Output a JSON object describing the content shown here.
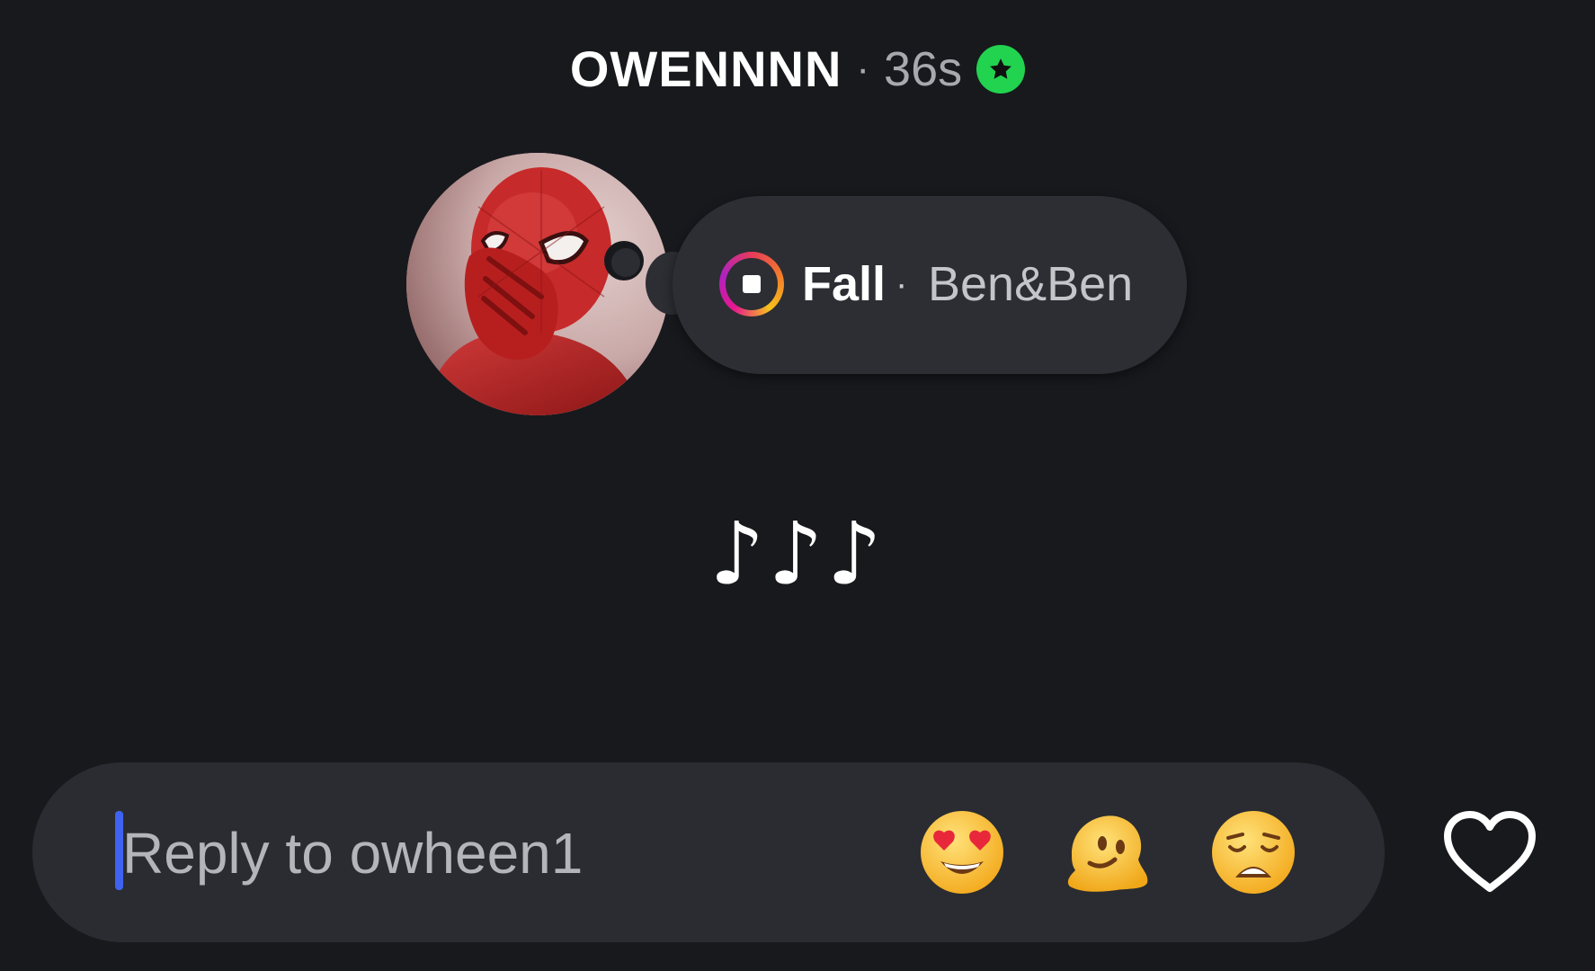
{
  "header": {
    "username": "OWENNNN",
    "separator": "·",
    "time": "36s",
    "badge_icon": "star-icon",
    "badge_color": "#21d34f"
  },
  "avatar": {
    "icon": "profile-photo"
  },
  "note": {
    "song_title": "Fall",
    "separator": "·",
    "artist": "Ben&Ben",
    "control_icon": "stop-icon"
  },
  "content": {
    "music_notes": "♪♪♪"
  },
  "reply": {
    "placeholder": "Reply to owheen1",
    "caret_color": "#3f63f0",
    "quick_reactions": [
      {
        "name": "heart-eyes-emoji"
      },
      {
        "name": "melting-face-emoji"
      },
      {
        "name": "weary-face-emoji"
      }
    ],
    "like_icon": "heart-outline-icon"
  },
  "colors": {
    "background": "#18191d",
    "bubble": "#2c2e33",
    "reply_bar": "#2a2c31"
  }
}
